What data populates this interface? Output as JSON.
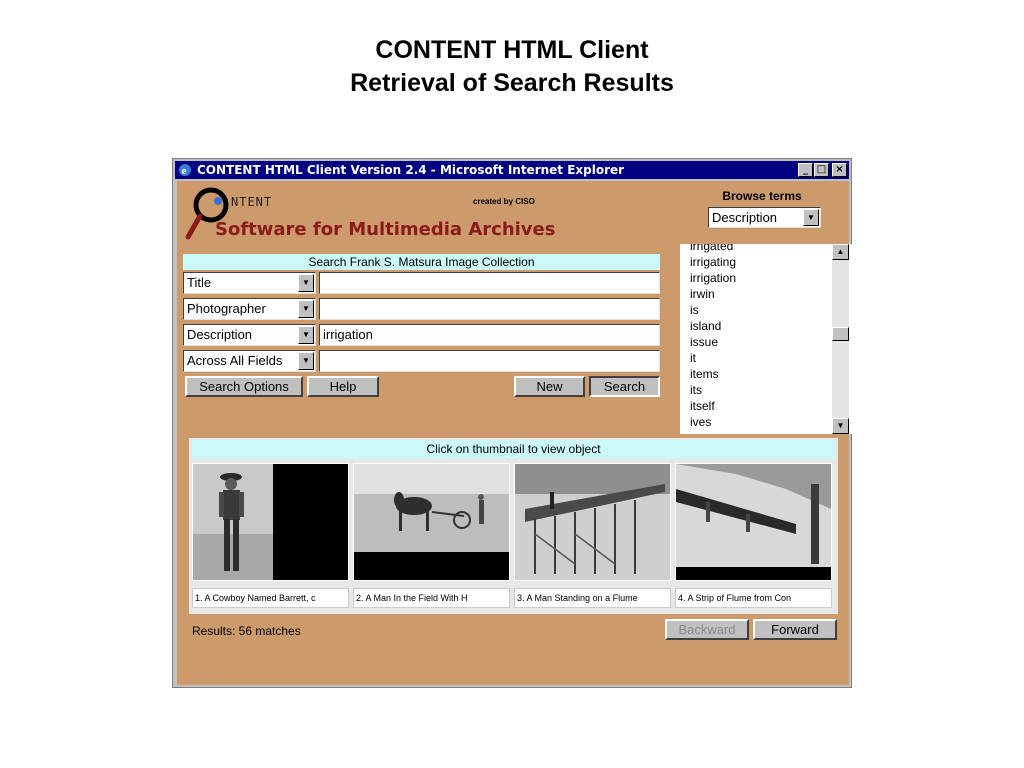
{
  "slide": {
    "title_line1": "CONTENT HTML Client",
    "title_line2": "Retrieval of Search Results"
  },
  "window": {
    "title": "CONTENT HTML Client Version 2.4 - Microsoft Internet Explorer",
    "minimize_glyph": "_",
    "maximize_glyph": "□",
    "close_glyph": "×"
  },
  "logo": {
    "ntent": "NTENT",
    "created_by": "created by CISO",
    "tagline": "Software for Multimedia Archives"
  },
  "browse": {
    "label": "Browse terms",
    "selected": "Description",
    "terms": [
      "irrigated",
      "irrigating",
      "irrigation",
      "irwin",
      "is",
      "island",
      "issue",
      "it",
      "items",
      "its",
      "itself",
      "ives"
    ]
  },
  "search": {
    "header": "Search Frank S. Matsura Image Collection",
    "rows": [
      {
        "field": "Title",
        "value": ""
      },
      {
        "field": "Photographer",
        "value": ""
      },
      {
        "field": "Description",
        "value": "irrigation"
      },
      {
        "field": "Across All Fields",
        "value": ""
      }
    ],
    "buttons": {
      "search_options": "Search Options",
      "help": "Help",
      "new": "New",
      "search": "Search"
    }
  },
  "results": {
    "header": "Click on thumbnail to view object",
    "captions": [
      "1. A Cowboy Named Barrett, c",
      "2. A Man In the Field With H",
      "3. A Man Standing on a Flume",
      "4. A Strip of Flume from Con"
    ],
    "summary": "Results: 56 matches",
    "backward": "Backward",
    "forward": "Forward"
  },
  "colors": {
    "page_bg": "#cd9b6b",
    "header_bg": "#cbf8f8",
    "titlebar": "#000080",
    "logo_text": "#8b1a1a"
  }
}
